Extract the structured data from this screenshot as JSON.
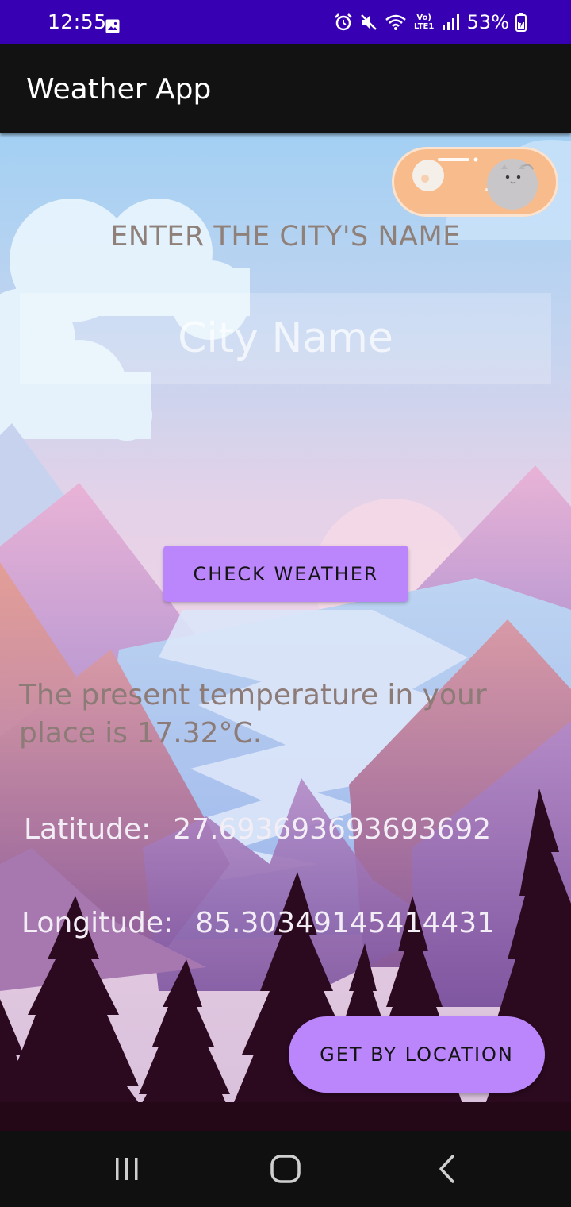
{
  "status_bar": {
    "time": "12:55",
    "network_label": "Vo) LTE1",
    "battery_percent": "53%",
    "icons": [
      "gallery-icon",
      "alarm-icon",
      "mute-icon",
      "wifi-icon",
      "volte-icon",
      "signal-icon",
      "battery-charging-icon"
    ]
  },
  "app_bar": {
    "title": "Weather App"
  },
  "theme_toggle": {
    "state": "day",
    "colors": {
      "track": "#f8bb8c",
      "knob": "#c8c6c8"
    }
  },
  "main": {
    "prompt_label": "ENTER THE CITY'S NAME",
    "city_input": {
      "value": "",
      "placeholder": "City Name"
    },
    "check_button_label": "CHECK WEATHER",
    "temperature_text": "The present temperature in your place is 17.32°C.",
    "latitude_label": "Latitude:",
    "latitude_value": "27.693693693693692",
    "longitude_label": "Longitude:",
    "longitude_value": "85.30349145414431",
    "location_button_label": "GET BY LOCATION"
  },
  "nav_bar": {
    "icons": [
      "recents-icon",
      "home-icon",
      "back-icon"
    ]
  },
  "colors": {
    "status_bar": "#3700b3",
    "app_bar": "#121212",
    "accent": "#bb86fc"
  }
}
